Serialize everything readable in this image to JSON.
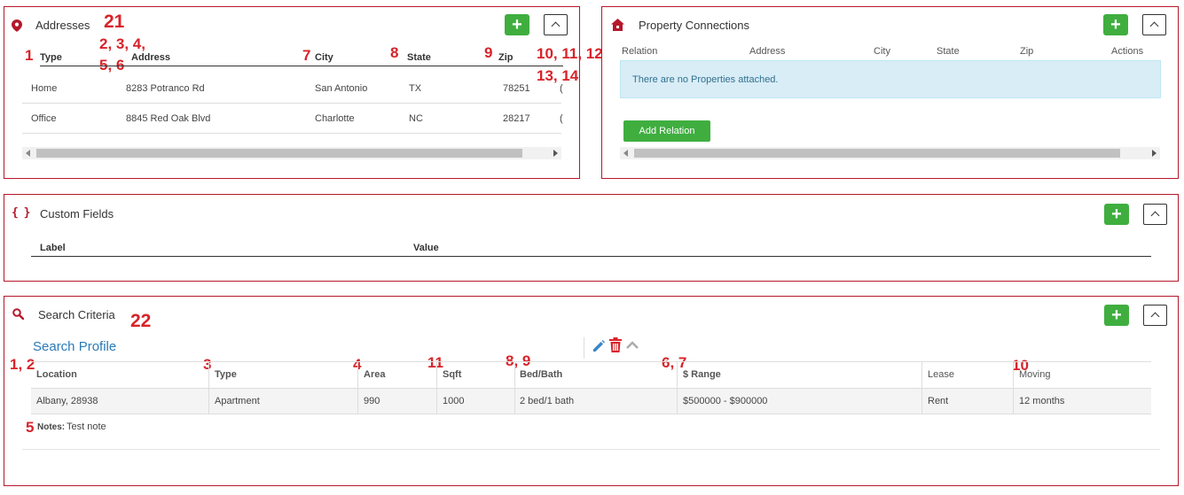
{
  "addresses": {
    "title": "Addresses",
    "icon": "map-pin-icon",
    "add_label": "+",
    "columns": [
      "Type",
      "Address",
      "City",
      "State",
      "Zip"
    ],
    "rows": [
      {
        "type": "Home",
        "address": "8283 Potranco Rd",
        "city": "San Antonio",
        "state": "TX",
        "zip": "78251",
        "trail": "("
      },
      {
        "type": "Office",
        "address": "8845 Red Oak Blvd",
        "city": "Charlotte",
        "state": "NC",
        "zip": "28217",
        "trail": "("
      }
    ],
    "annotations": {
      "type": "1",
      "address_a": "2, 3, 4,",
      "address_b": "5, 6",
      "city": "7",
      "state": "8",
      "zip": "9",
      "more_a": "10, 11, 12,",
      "more_b": "13, 14",
      "title": "21"
    }
  },
  "property": {
    "title": "Property Connections",
    "icon": "house-icon",
    "add_label": "+",
    "columns": [
      "Relation",
      "Address",
      "City",
      "State",
      "Zip",
      "Actions"
    ],
    "empty_message": "There are no Properties attached.",
    "add_relation_label": "Add Relation"
  },
  "custom_fields": {
    "title": "Custom Fields",
    "icon": "braces-icon",
    "icon_text": "{ }",
    "add_label": "+",
    "columns": [
      "Label",
      "Value"
    ]
  },
  "search": {
    "title": "Search Criteria",
    "icon": "search-icon",
    "add_label": "+",
    "profile_title": "Search Profile",
    "columns": [
      "Location",
      "Type",
      "Area",
      "Sqft",
      "Bed/Bath",
      "$ Range",
      "Lease",
      "Moving"
    ],
    "row": {
      "location": "Albany, 28938",
      "type": "Apartment",
      "area": "990",
      "sqft": "1000",
      "bedbath": "2 bed/1 bath",
      "range": "$500000 - $900000",
      "lease": "Rent",
      "moving": "12 months"
    },
    "notes_label": "Notes:",
    "notes_value": "Test note",
    "annotations": {
      "location": "1, 2",
      "type": "3",
      "area": "4",
      "sqft": "11",
      "bedbath": "8, 9",
      "range": "6, 7",
      "moving": "10",
      "notes": "5",
      "title": "22"
    }
  },
  "colors": {
    "panel_border": "#b5182b",
    "accent_red": "#d8232a",
    "green": "#3fae3f",
    "link_blue": "#2a7ab8",
    "info_bg": "#d9edf7"
  }
}
